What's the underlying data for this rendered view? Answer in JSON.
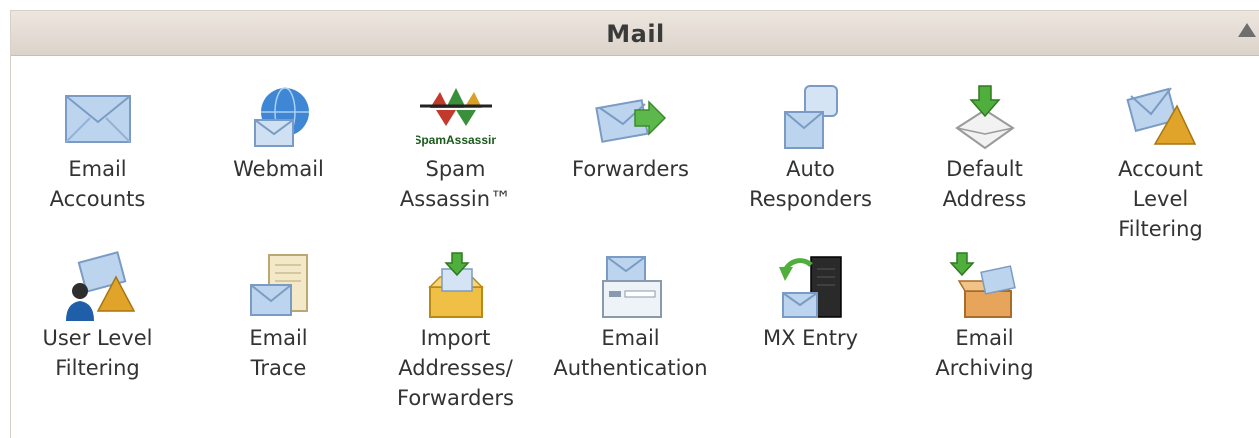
{
  "section": {
    "title": "Mail"
  },
  "items": [
    {
      "label": "Email\nAccounts",
      "icon": "envelope-icon"
    },
    {
      "label": "Webmail",
      "icon": "globe-envelope-icon"
    },
    {
      "label": "Spam\nAssassin™",
      "icon": "spamassassin-logo-icon",
      "logo_text": "SpamAssassin"
    },
    {
      "label": "Forwarders",
      "icon": "forward-envelope-icon"
    },
    {
      "label": "Auto\nResponders",
      "icon": "auto-responder-icon"
    },
    {
      "label": "Default\nAddress",
      "icon": "default-address-icon"
    },
    {
      "label": "Account\nLevel\nFiltering",
      "icon": "funnel-envelope-icon"
    },
    {
      "label": "User Level\nFiltering",
      "icon": "user-filter-icon"
    },
    {
      "label": "Email\nTrace",
      "icon": "trace-icon"
    },
    {
      "label": "Import\nAddresses/\nForwarders",
      "icon": "import-box-icon"
    },
    {
      "label": "Email\nAuthentication",
      "icon": "authentication-icon"
    },
    {
      "label": "MX Entry",
      "icon": "mx-server-icon"
    },
    {
      "label": "Email\nArchiving",
      "icon": "archive-box-icon"
    }
  ]
}
